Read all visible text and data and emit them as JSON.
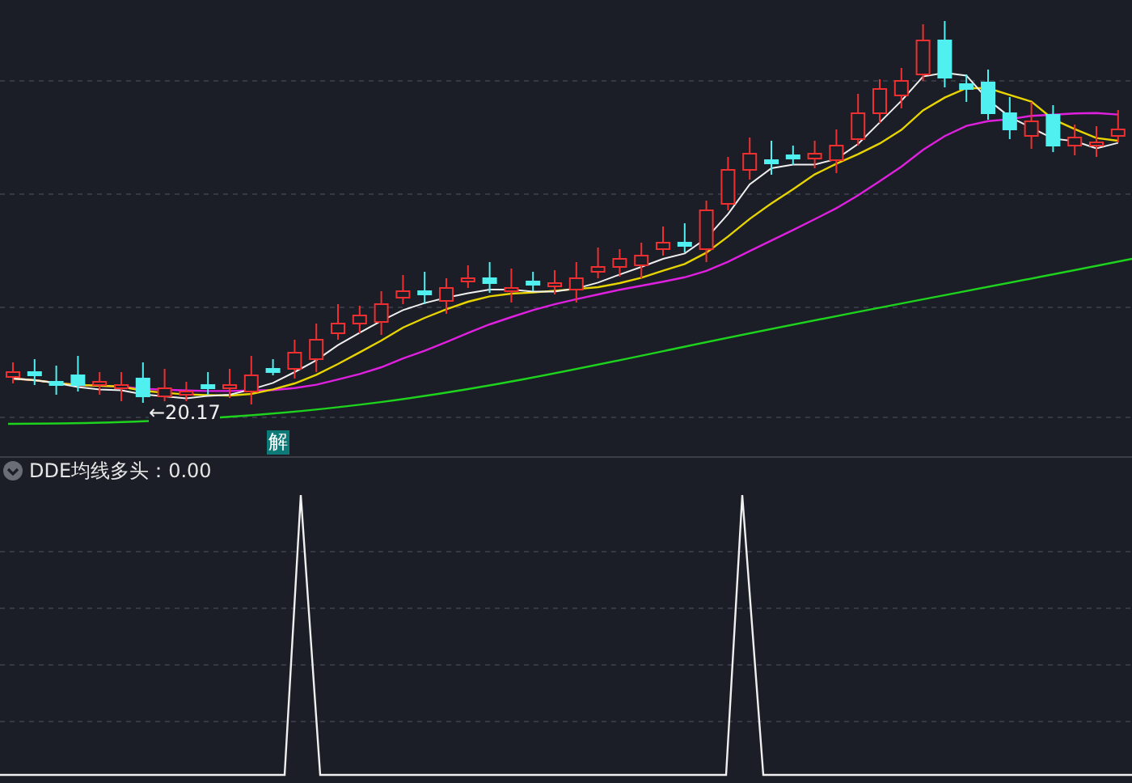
{
  "price_chart": {
    "low_marker": {
      "arrow": "←",
      "value": "20.17"
    },
    "signal_badge": "解"
  },
  "indicator": {
    "expanded": true,
    "label": "DDE均线多头：0.00"
  }
}
